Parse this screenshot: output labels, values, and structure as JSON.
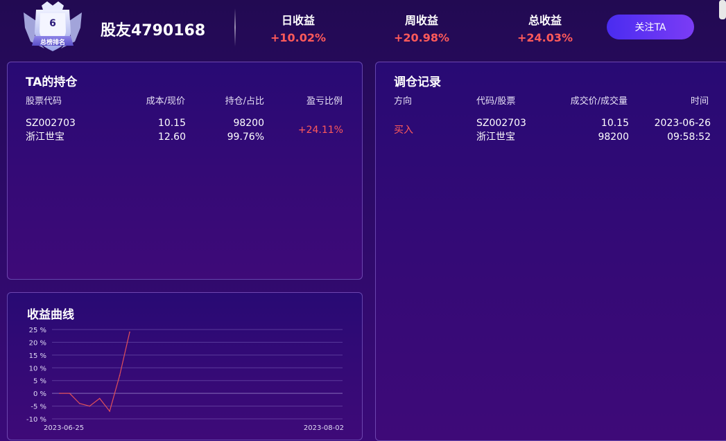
{
  "header": {
    "rank_number": "6",
    "rank_label": "总榜排名",
    "username": "股友4790168",
    "stats": [
      {
        "label": "日收益",
        "value": "+10.02%"
      },
      {
        "label": "周收益",
        "value": "+20.98%"
      },
      {
        "label": "总收益",
        "value": "+24.03%"
      }
    ],
    "follow_button": "关注TA"
  },
  "holdings": {
    "title": "TA的持仓",
    "columns": [
      "股票代码",
      "成本/现价",
      "持仓/占比",
      "盈亏比例"
    ],
    "rows": [
      {
        "code": "SZ002703",
        "name": "浙江世宝",
        "cost": "10.15",
        "price": "12.60",
        "position": "98200",
        "ratio": "99.76%",
        "pnl": "+24.11%"
      }
    ]
  },
  "trades": {
    "title": "调仓记录",
    "columns": [
      "方向",
      "代码/股票",
      "成交价/成交量",
      "时间"
    ],
    "rows": [
      {
        "direction": "买入",
        "code": "SZ002703",
        "name": "浙江世宝",
        "price": "10.15",
        "volume": "98200",
        "date": "2023-06-26",
        "time": "09:58:52"
      }
    ]
  },
  "curve": {
    "title": "收益曲线"
  },
  "colors": {
    "up": "#ff5a5a",
    "accent": "#6a34f2",
    "line": "#e0505a"
  },
  "chart_data": {
    "type": "line",
    "title": "收益曲线",
    "xlabel": "",
    "ylabel": "",
    "x_ticks": [
      "2023-06-25",
      "2023-08-02"
    ],
    "y_ticks": [
      "25 %",
      "20 %",
      "15 %",
      "10 %",
      "5 %",
      "0 %",
      "-5 %",
      "-10 %"
    ],
    "ylim": [
      -10,
      25
    ],
    "grid": true,
    "series": [
      {
        "values": [
          0,
          0,
          -4,
          -5,
          -2,
          -7,
          7,
          24
        ]
      }
    ]
  }
}
